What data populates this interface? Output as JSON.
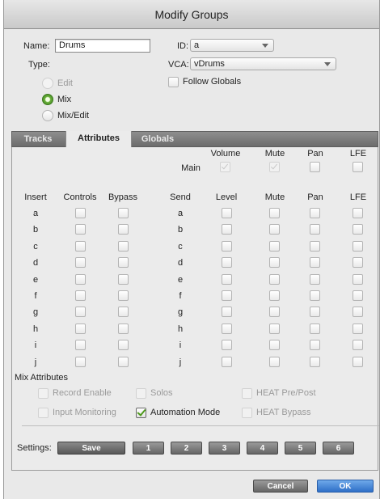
{
  "window": {
    "title": "Modify Groups"
  },
  "top": {
    "name_label": "Name:",
    "name_value": "Drums",
    "id_label": "ID:",
    "id_value": "a",
    "type_label": "Type:",
    "vca_label": "VCA:",
    "vca_value": "vDrums",
    "follow_globals_label": "Follow Globals",
    "type_options": [
      {
        "label": "Edit",
        "state": "disabled"
      },
      {
        "label": "Mix",
        "state": "selected"
      },
      {
        "label": "Mix/Edit",
        "state": "normal"
      }
    ]
  },
  "tabs": [
    {
      "label": "Tracks",
      "active": false
    },
    {
      "label": "Attributes",
      "active": true
    },
    {
      "label": "Globals",
      "active": false
    }
  ],
  "attributes": {
    "main_label": "Main",
    "main_headers": [
      "Volume",
      "Mute",
      "Pan",
      "LFE"
    ],
    "main_disabled": [
      true,
      true,
      false,
      false
    ],
    "insert_headers": [
      "Insert",
      "Controls",
      "Bypass"
    ],
    "send_headers": [
      "Send",
      "Level",
      "Mute",
      "Pan",
      "LFE"
    ],
    "rows": [
      "a",
      "b",
      "c",
      "d",
      "e",
      "f",
      "g",
      "h",
      "i",
      "j"
    ],
    "mix_attributes_title": "Mix Attributes",
    "mix_attributes": [
      {
        "label": "Record Enable",
        "enabled": false,
        "checked": false
      },
      {
        "label": "Input Monitoring",
        "enabled": false,
        "checked": false
      },
      {
        "label": "Solos",
        "enabled": false,
        "checked": false
      },
      {
        "label": "Automation Mode",
        "enabled": true,
        "checked": true
      },
      {
        "label": "HEAT Pre/Post",
        "enabled": false,
        "checked": false
      },
      {
        "label": "HEAT Bypass",
        "enabled": false,
        "checked": false
      }
    ]
  },
  "settings": {
    "label": "Settings:",
    "save_label": "Save",
    "presets": [
      "1",
      "2",
      "3",
      "4",
      "5",
      "6"
    ]
  },
  "footer": {
    "cancel_label": "Cancel",
    "ok_label": "OK"
  },
  "colors": {
    "accent_blue": "#2e6fc7",
    "check_green": "#4e9a1c",
    "tab_bar": "#7a7a7a"
  }
}
